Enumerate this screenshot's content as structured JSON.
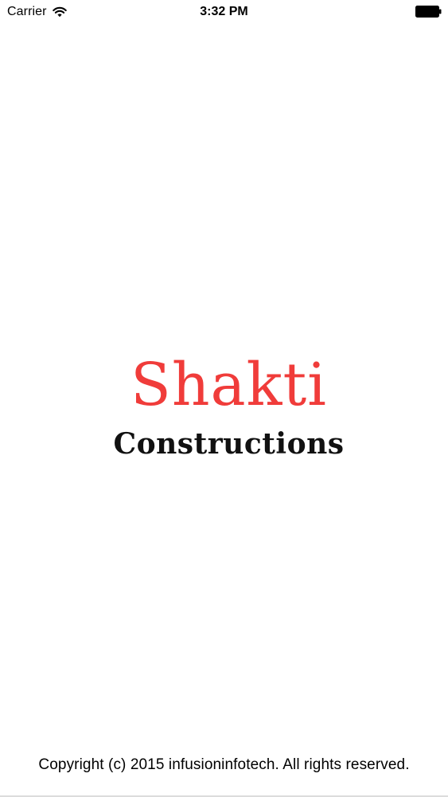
{
  "status_bar": {
    "carrier": "Carrier",
    "time": "3:32 PM",
    "wifi_icon": "wifi-icon",
    "battery_icon": "battery-full-icon"
  },
  "splash": {
    "brand_name": "Shakti",
    "brand_sub": "Constructions",
    "brand_color": "#f03c3a",
    "sub_color": "#111111"
  },
  "footer": {
    "copyright": "Copyright (c) 2015 infusioninfotech. All rights reserved."
  }
}
